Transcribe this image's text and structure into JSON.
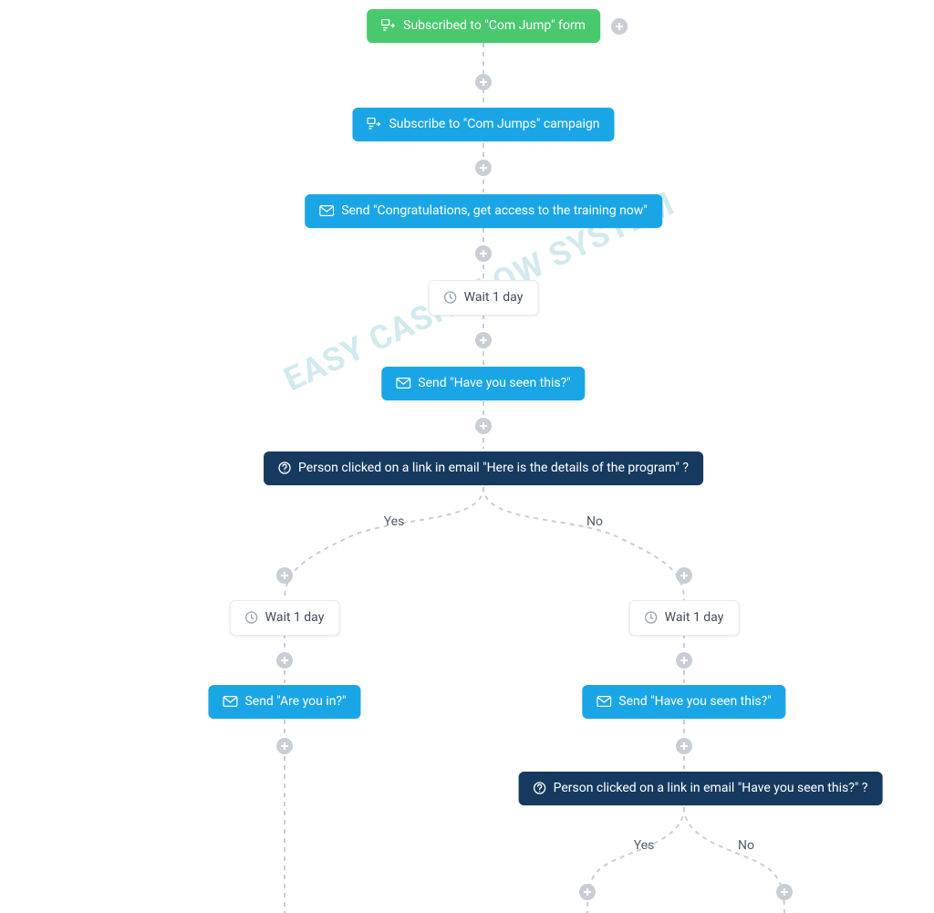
{
  "watermark": "EASY CASH FLOW SYSTEM",
  "labels": {
    "yes": "Yes",
    "no": "No"
  },
  "nodes": {
    "trigger": "Subscribed to \"Com Jump\" form",
    "subscribe": "Subscribe to \"Com Jumps\" campaign",
    "send_congrats": "Send \"Congratulations, get access to the training now\"",
    "wait1": "Wait 1 day",
    "send_seen": "Send \"Have you seen this?\"",
    "cond1": "Person clicked on a link in email \"Here is the details of the program\" ?",
    "wait_yes": "Wait 1 day",
    "wait_no": "Wait 1 day",
    "send_in": "Send \"Are you in?\"",
    "send_seen2": "Send \"Have you seen this?\"",
    "cond2": "Person clicked on a link in email \"Have you seen this?\" ?"
  }
}
